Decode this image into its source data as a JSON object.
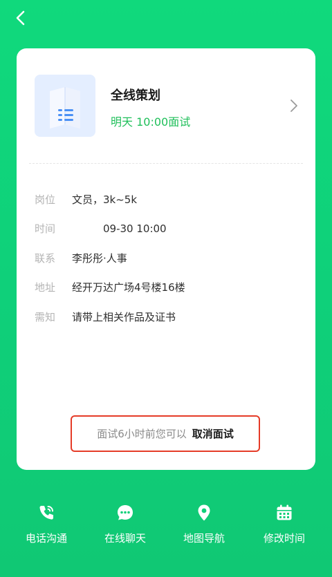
{
  "nav": {
    "back_icon": "chevron-left-icon"
  },
  "card": {
    "company_name": "全线策划",
    "interview_time": "明天 10:00面试",
    "logo_icon": "folded-map-icon",
    "chevron_icon": "chevron-right-icon",
    "details": [
      {
        "label": "岗位",
        "value": "文员，3k~5k"
      },
      {
        "label": "时间",
        "value": "09-30 10:00"
      },
      {
        "label": "联系",
        "value": "李彤彤·人事"
      },
      {
        "label": "地址",
        "value": "经开万达广场4号楼16楼"
      },
      {
        "label": "需知",
        "value": "请带上相关作品及证书"
      }
    ],
    "cancel_tip": "面试6小时前您可以",
    "cancel_link": "取消面试"
  },
  "actions": [
    {
      "label": "电话沟通",
      "icon": "phone-icon"
    },
    {
      "label": "在线聊天",
      "icon": "chat-bubble-icon"
    },
    {
      "label": "地图导航",
      "icon": "map-pin-icon"
    },
    {
      "label": "修改时间",
      "icon": "calendar-icon"
    }
  ],
  "colors": {
    "background": "#10d27a",
    "accent_green": "#1fbf5a",
    "highlight_red": "#e53b27"
  }
}
